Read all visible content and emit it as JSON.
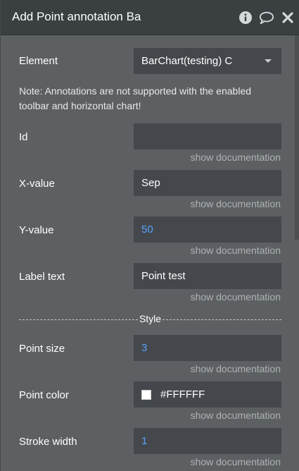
{
  "header": {
    "title": "Add Point annotation Ba",
    "icons": [
      "info-icon",
      "comment-icon",
      "close-icon"
    ]
  },
  "element": {
    "label": "Element",
    "value": "BarChart(testing) C"
  },
  "note": "Note: Annotations are not supported with the enabled toolbar and horizontal chart!",
  "fields": {
    "id": {
      "label": "Id",
      "value": "",
      "doc": "show documentation"
    },
    "x_value": {
      "label": "X-value",
      "value": "Sep",
      "doc": "show documentation"
    },
    "y_value": {
      "label": "Y-value",
      "value": "50",
      "doc": "show documentation"
    },
    "label_text": {
      "label": "Label text",
      "value": "Point test",
      "doc": "show documentation"
    },
    "point_size": {
      "label": "Point size",
      "value": "3",
      "doc": "show documentation"
    },
    "point_color": {
      "label": "Point color",
      "value": "#FFFFFF",
      "doc": "show documentation"
    },
    "stroke_width": {
      "label": "Stroke width",
      "value": "1",
      "doc": "show documentation"
    }
  },
  "style_divider": "Style",
  "colors": {
    "panel_bg": "#5c6063",
    "header_bg": "#3a3f42",
    "field_bg": "#44484c",
    "dynamic_value": "#5aa0ff",
    "point_color_swatch": "#FFFFFF"
  }
}
